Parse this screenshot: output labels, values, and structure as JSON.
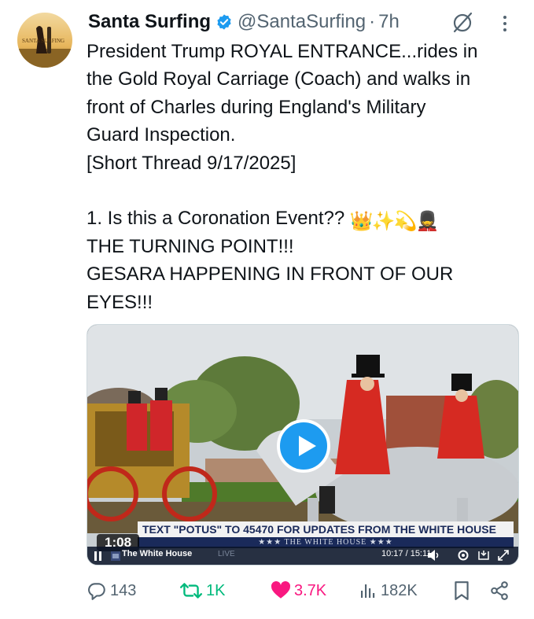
{
  "author": {
    "display_name": "Santa Surfing",
    "handle": "@SantaSurfing",
    "separator": "·",
    "time": "7h",
    "avatar_text": "SANTA SURFING"
  },
  "tweet": {
    "lines": [
      "President Trump ROYAL ENTRANCE...rides in",
      "the Gold Royal Carriage (Coach) and walks in",
      "front of Charles during England's Military",
      "Guard Inspection.",
      "[Short Thread 9/17/2025]",
      "",
      "1. Is this a Coronation Event?? ",
      "THE TURNING POINT!!!",
      "GESARA HAPPENING IN FRONT OF OUR",
      "EYES!!!"
    ],
    "emojis": [
      "👑",
      "✨",
      "💫",
      "💂"
    ]
  },
  "video": {
    "banner_text": "TEXT \"POTUS\" TO 45470 FOR UPDATES FROM THE WHITE HOUSE",
    "banner_subtext": "★★★  THE WHITE HOUSE  ★★★",
    "duration": "1:08",
    "channel_label": "The White House",
    "live_label": "LIVE",
    "playback_time": "10:17 / 15:11"
  },
  "actions": {
    "replies": "143",
    "retweets": "1K",
    "likes": "3.7K",
    "views": "182K"
  },
  "colors": {
    "accent": "#1d9bf0",
    "retweet": "#00ba7c",
    "like": "#f91880",
    "muted": "#536471"
  }
}
